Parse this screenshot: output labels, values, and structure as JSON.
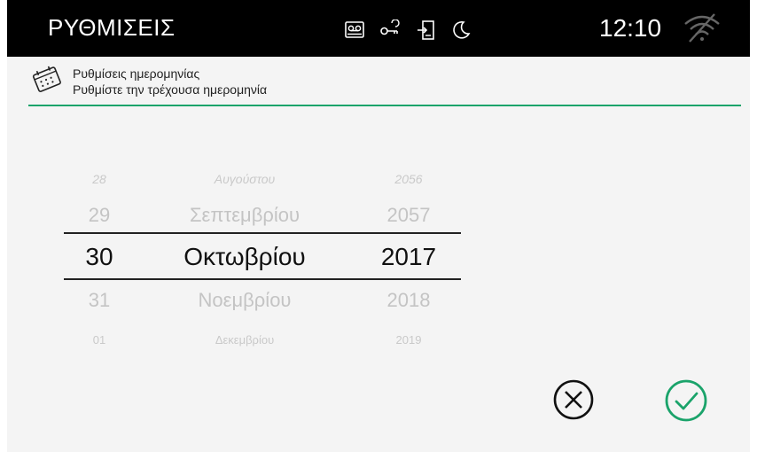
{
  "topbar": {
    "title": "ΡΥΘΜΙΣΕΙΣ",
    "time": "12:10",
    "status_icons": [
      "voicemail-icon",
      "key-icon",
      "door-entry-icon",
      "moon-icon"
    ],
    "wifi_icon": "wifi-off-icon"
  },
  "header": {
    "icon": "calendar-icon",
    "title": "Ρυθμίσεις ημερομηνίας",
    "subtitle": "Ρυθμίστε την τρέχουσα ημερομηνία"
  },
  "picker": {
    "day": {
      "items": [
        "28",
        "29",
        "30",
        "31",
        "01"
      ],
      "selected": "30"
    },
    "month": {
      "items": [
        "Αυγούστου",
        "Σεπτεμβρίου",
        "Οκτωβρίου",
        "Νοεμβρίου",
        "Δεκεμβρίου"
      ],
      "selected": "Οκτωβρίου"
    },
    "year": {
      "items": [
        "2056",
        "2057",
        "2017",
        "2018",
        "2019"
      ],
      "selected": "2017"
    }
  },
  "actions": {
    "cancel_icon": "cancel-circle-icon",
    "confirm_icon": "check-circle-icon"
  },
  "colors": {
    "accent": "#1aa36a",
    "topbar_bg": "#000000",
    "background": "#f4f4f4"
  }
}
